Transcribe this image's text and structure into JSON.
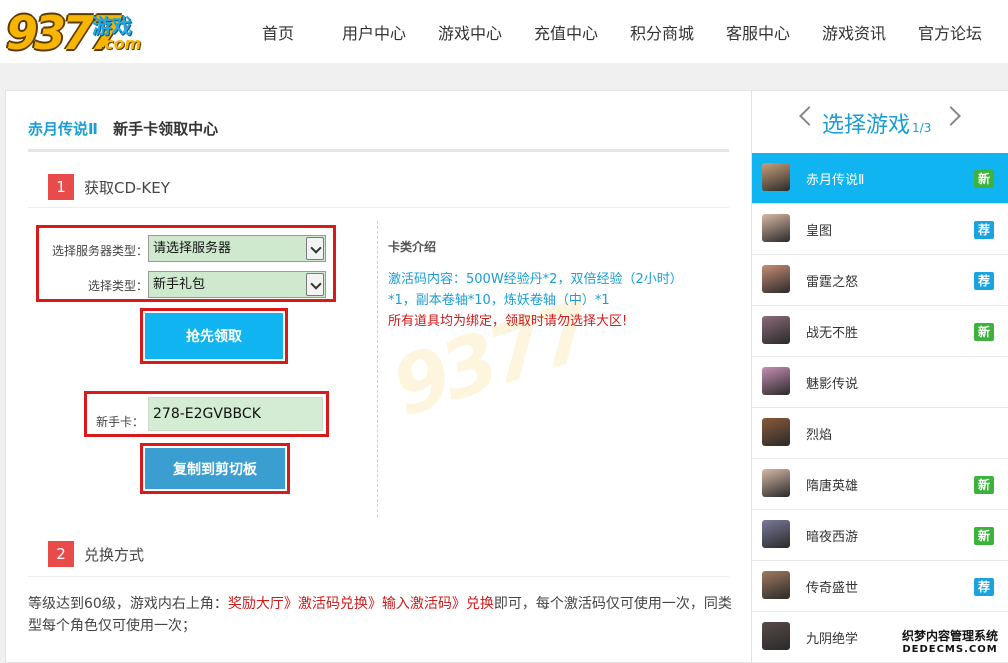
{
  "header": {
    "logo_number": "9377",
    "logo_cn": "游戏",
    "logo_com": ".com",
    "nav": [
      "首页",
      "用户中心",
      "游戏中心",
      "充值中心",
      "积分商城",
      "客服中心",
      "游戏资讯",
      "官方论坛"
    ]
  },
  "main": {
    "game_name": "赤月传说Ⅱ",
    "page_title": "新手卡领取中心",
    "step1": {
      "num": "1",
      "title": "获取CD-KEY"
    },
    "server_type_label": "选择服务器类型：",
    "server_select_value": "请选择服务器",
    "type_label": "选择类型：",
    "type_select_value": "新手礼包",
    "claim_button": "抢先领取",
    "card_label": "新手卡：",
    "card_value": "278-E2GVBBCK",
    "copy_button": "复制到剪切板",
    "intro_title": "卡类介绍",
    "intro_line1": "激活码内容：500W经验丹*2，双倍经验（2小时）",
    "intro_line2": "*1，副本卷轴*10，炼妖卷轴（中）*1",
    "intro_warn": "所有道具均为绑定，领取时请勿选择大区!",
    "step2": {
      "num": "2",
      "title": "兑换方式"
    },
    "howto_prefix": "等级达到60级，游戏内右上角：",
    "howto_path": "奖励大厅》激活码兑换》输入激活码》兑换",
    "howto_suffix": "即可，每个激活码仅可使用一次，同类型每个角色仅可使用一次；"
  },
  "sidebar": {
    "title": "选择游戏",
    "page": "1/3",
    "games": [
      {
        "name": "赤月传说Ⅱ",
        "tag": "新",
        "tag_type": "new",
        "active": true,
        "color": "#c9a07a"
      },
      {
        "name": "皇图",
        "tag": "荐",
        "tag_type": "rec",
        "active": false,
        "color": "#d7b9a4"
      },
      {
        "name": "雷霆之怒",
        "tag": "荐",
        "tag_type": "rec",
        "active": false,
        "color": "#c98c77"
      },
      {
        "name": "战无不胜",
        "tag": "新",
        "tag_type": "new",
        "active": false,
        "color": "#8c6a7a"
      },
      {
        "name": "魅影传说",
        "tag": "",
        "tag_type": "",
        "active": false,
        "color": "#c58fb5"
      },
      {
        "name": "烈焰",
        "tag": "",
        "tag_type": "",
        "active": false,
        "color": "#8a5a3a"
      },
      {
        "name": "隋唐英雄",
        "tag": "新",
        "tag_type": "new",
        "active": false,
        "color": "#d6b8a8"
      },
      {
        "name": "暗夜西游",
        "tag": "新",
        "tag_type": "new",
        "active": false,
        "color": "#7a7a9a"
      },
      {
        "name": "传奇盛世",
        "tag": "荐",
        "tag_type": "rec",
        "active": false,
        "color": "#a07a60"
      },
      {
        "name": "九阴绝学",
        "tag": "",
        "tag_type": "",
        "active": false,
        "color": "#5a4a4a"
      }
    ]
  },
  "corner_watermark": {
    "line1": "织梦内容管理系统",
    "line2": "DEDECMS.COM"
  }
}
